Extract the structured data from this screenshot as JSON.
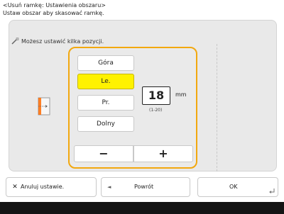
{
  "header": {
    "line1": "<Usuń ramkę: Ustawienia obszaru>",
    "line2": "Ustaw obszar aby skasować ramkę."
  },
  "panel": {
    "title": "Możesz ustawić kilka pozycji."
  },
  "positions": [
    {
      "label": "Góra",
      "selected": false
    },
    {
      "label": "Le.",
      "selected": true
    },
    {
      "label": "Pr.",
      "selected": false
    },
    {
      "label": "Dolny",
      "selected": false
    }
  ],
  "value": {
    "amount": "18",
    "unit": "mm",
    "range": "(1-20)"
  },
  "stepper": {
    "minus": "−",
    "plus": "+"
  },
  "footer": {
    "cancel_label": "Anuluj ustawie.",
    "back_label": "Powrót",
    "ok_label": "OK"
  },
  "colors": {
    "accent_frame": "#f2a80f",
    "selected_button": "#fff200",
    "bottom_bar": "#141414"
  },
  "icons": {
    "title": "magic-wand-icon",
    "preview": "page-margin-left-icon",
    "cancel": "close-icon",
    "back": "back-arrow-icon",
    "ok": "enter-icon"
  }
}
